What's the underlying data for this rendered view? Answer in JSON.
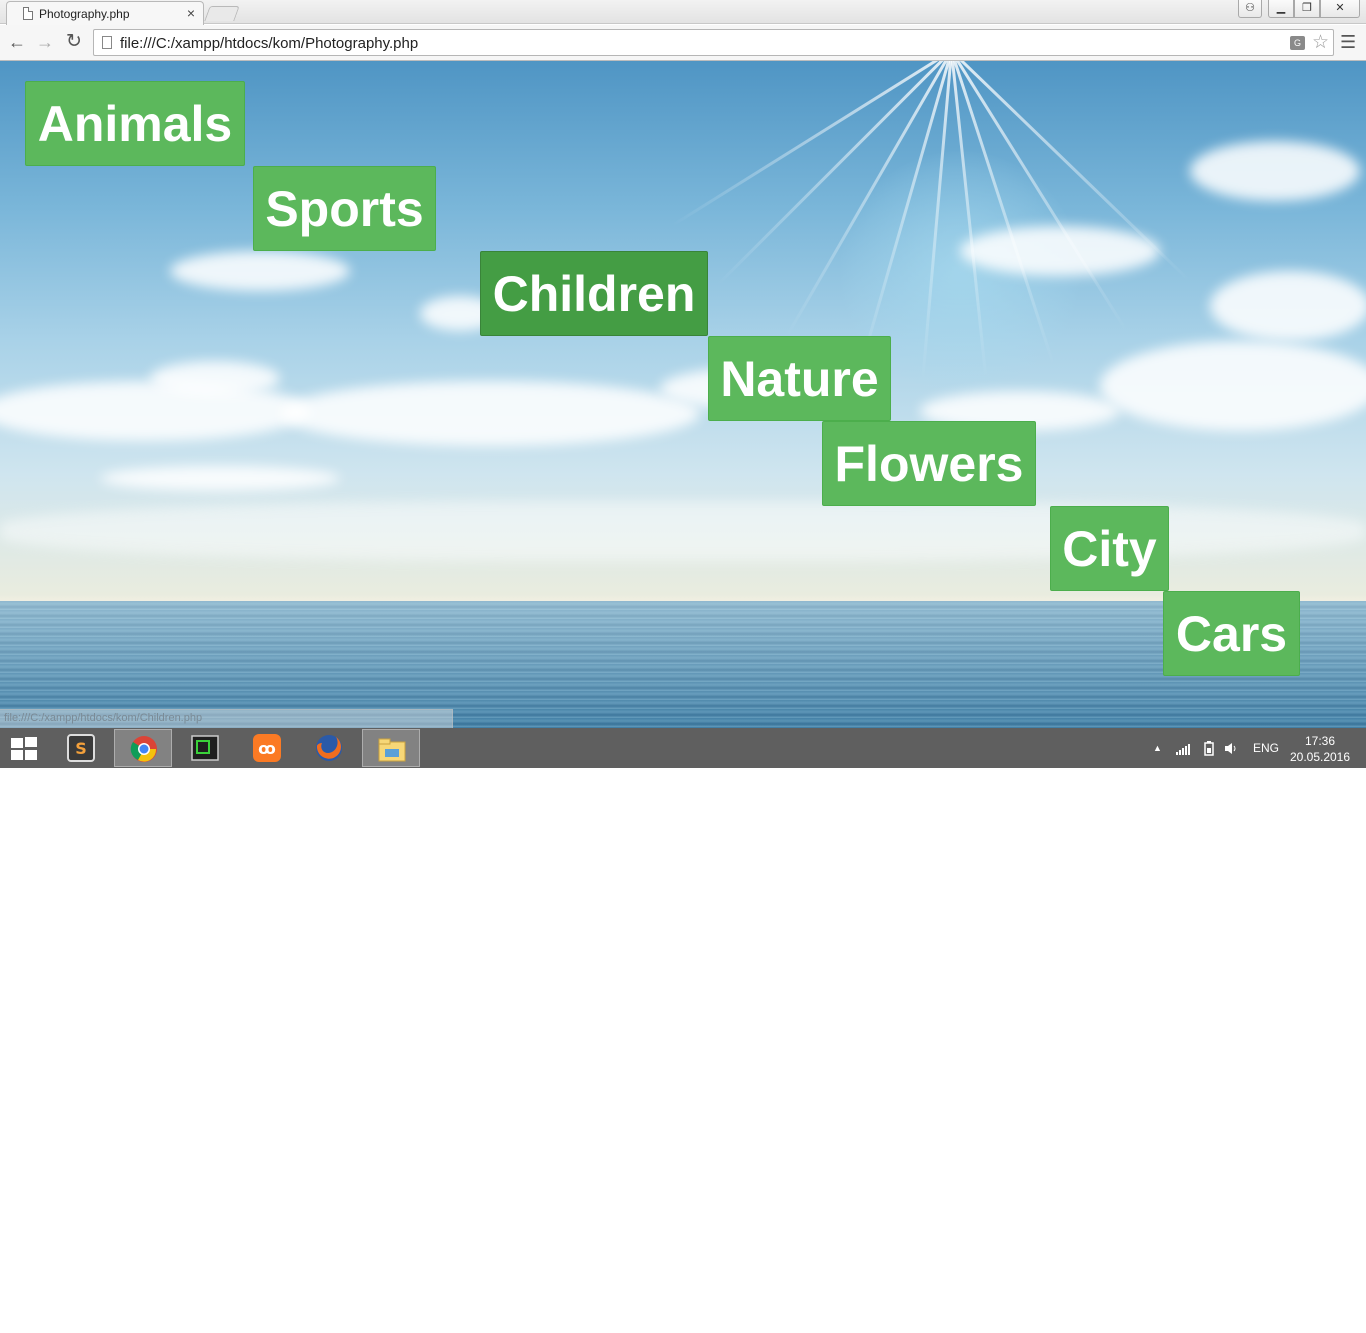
{
  "browser": {
    "tab_title": "Photography.php",
    "tab_close": "×",
    "url": "file:///C:/xampp/htdocs/kom/Photography.php",
    "status_url": "file:///C:/xampp/htdocs/kom/Children.php"
  },
  "page": {
    "categories": [
      {
        "label": "Animals",
        "active": false
      },
      {
        "label": "Sports",
        "active": false
      },
      {
        "label": "Children",
        "active": true
      },
      {
        "label": "Nature",
        "active": false
      },
      {
        "label": "Flowers",
        "active": false
      },
      {
        "label": "City",
        "active": false
      },
      {
        "label": "Cars",
        "active": false
      }
    ],
    "button_color": "#5cb85c",
    "button_hover_color": "#449d44"
  },
  "taskbar": {
    "apps": [
      "sublime-text-icon",
      "chrome-icon",
      "terminal-icon",
      "xampp-icon",
      "firefox-icon",
      "file-explorer-icon"
    ],
    "language": "ENG",
    "time": "17:36",
    "date": "20.05.2016"
  }
}
